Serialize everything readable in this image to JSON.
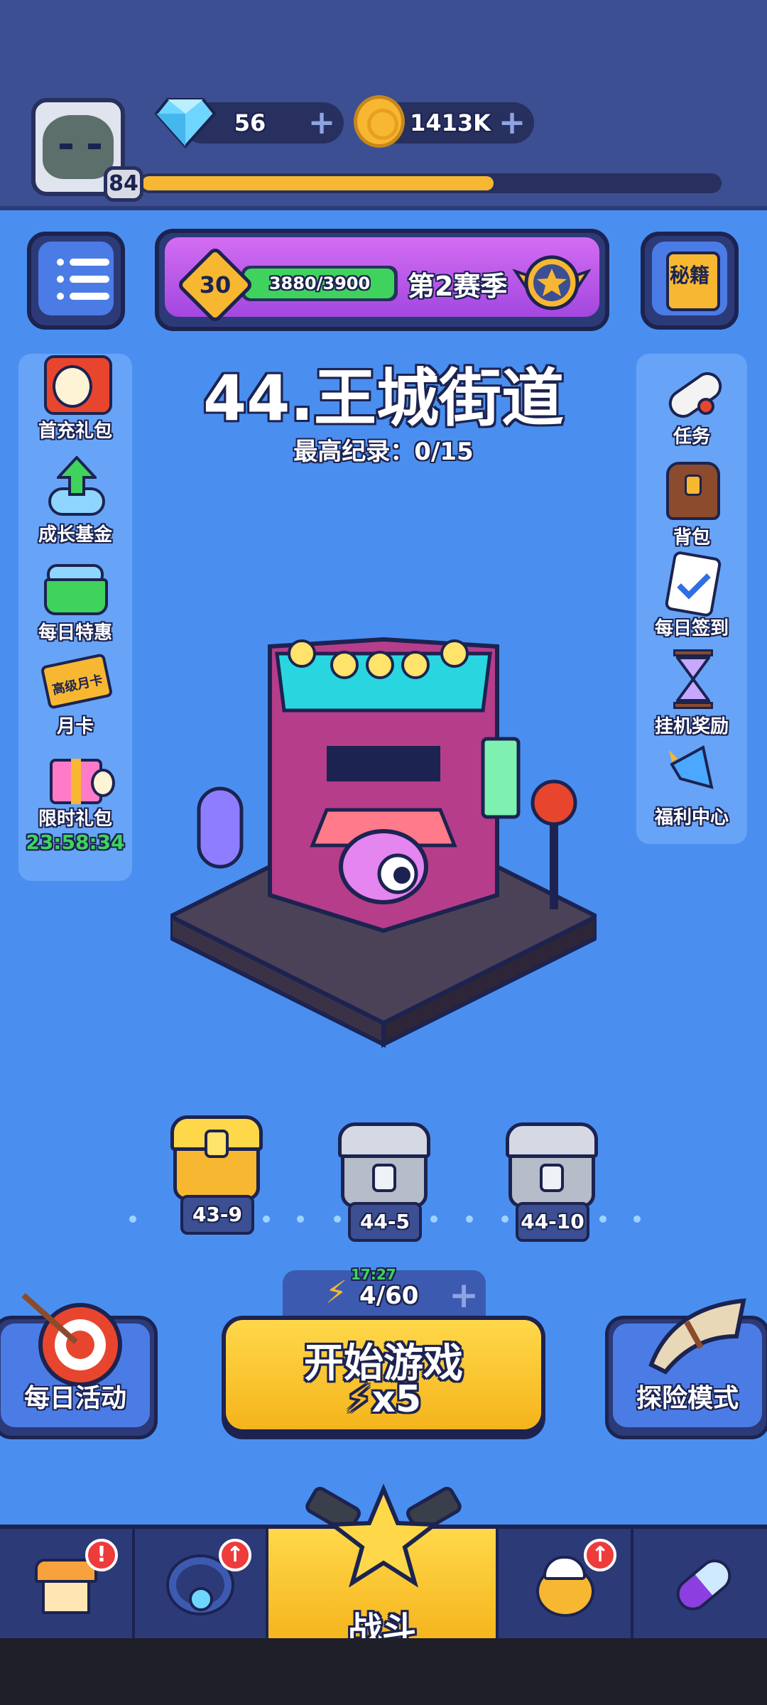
{
  "player": {
    "level": "84",
    "xp_progress": 0.61
  },
  "currency": {
    "gems": "56",
    "coins": "1413K"
  },
  "season": {
    "level": "30",
    "progress_text": "3880/3900",
    "progress": 0.995,
    "name": "第2赛季"
  },
  "book_button": {
    "label": "秘籍"
  },
  "left_menu": [
    {
      "id": "first-recharge",
      "label": "首充礼包",
      "icon": "gift-chest-icon"
    },
    {
      "id": "growth-fund",
      "label": "成长基金",
      "icon": "growth-arrow-icon"
    },
    {
      "id": "daily-deal",
      "label": "每日特惠",
      "icon": "basket-icon"
    },
    {
      "id": "monthly-card",
      "label": "月卡",
      "icon": "card-icon",
      "card_text": "高级月卡"
    },
    {
      "id": "limited-pack",
      "label": "限时礼包",
      "icon": "gift-box-icon",
      "timer": "23:58:34"
    }
  ],
  "right_menu": [
    {
      "id": "tasks",
      "label": "任务",
      "icon": "scroll-icon"
    },
    {
      "id": "backpack",
      "label": "背包",
      "icon": "backpack-icon"
    },
    {
      "id": "daily-signin",
      "label": "每日签到",
      "icon": "clipboard-check-icon"
    },
    {
      "id": "idle-reward",
      "label": "挂机奖励",
      "icon": "hourglass-icon"
    },
    {
      "id": "welfare",
      "label": "福利中心",
      "icon": "megaphone-icon"
    }
  ],
  "stage": {
    "title": "44.王城街道",
    "record": "最高纪录：0/15"
  },
  "chests": [
    {
      "label": "43-9",
      "state": "opened"
    },
    {
      "label": "44-5",
      "state": "locked"
    },
    {
      "label": "44-10",
      "state": "locked"
    }
  ],
  "energy": {
    "timer": "17:27",
    "count": "4/60"
  },
  "start_button": {
    "label": "开始游戏",
    "cost": "x5"
  },
  "daily_activity": {
    "label": "每日活动"
  },
  "adventure_mode": {
    "label": "探险模式"
  },
  "bottom_nav": [
    {
      "id": "shop",
      "icon": "shop-icon",
      "badge": "!"
    },
    {
      "id": "equipment",
      "icon": "ring-icon",
      "badge": "↑"
    },
    {
      "id": "battle",
      "icon": "star-cannon-icon",
      "label": "战斗",
      "active": true
    },
    {
      "id": "pets",
      "icon": "chick-icon",
      "badge": "↑"
    },
    {
      "id": "items",
      "icon": "capsule-icon"
    }
  ],
  "colors": {
    "background": "#4a8ff0",
    "accent_yellow": "#f7b731",
    "navy": "#1c2350",
    "purple": "#a347e0",
    "green": "#3fd35e"
  }
}
